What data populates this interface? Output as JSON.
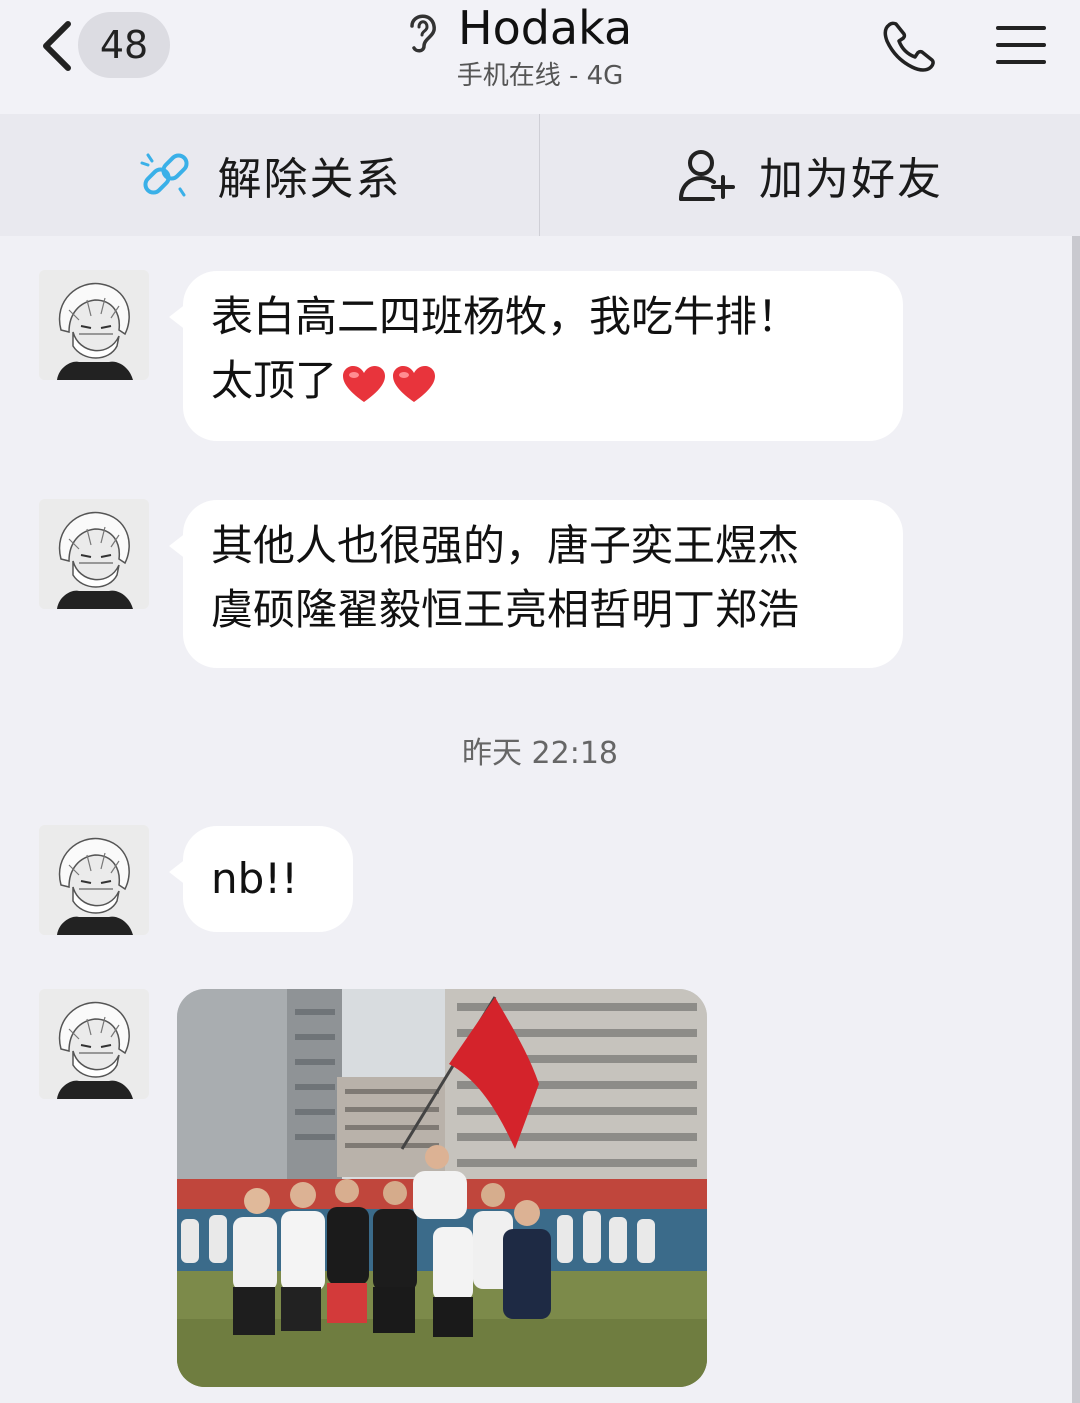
{
  "header": {
    "unread_count": "48",
    "title": "Hodaka",
    "status": "手机在线 - 4G"
  },
  "actions": {
    "unlink_label": "解除关系",
    "add_friend_label": "加为好友"
  },
  "messages": [
    {
      "lines": [
        "表白高二四班杨牧，我吃牛排！",
        "太顶了"
      ],
      "emoji_count": 2
    },
    {
      "lines": [
        "其他人也很强的，唐子奕王煜杰",
        "虞硕隆翟毅恒王亮相哲明丁郑浩"
      ]
    },
    {
      "lines": [
        "nb!!"
      ]
    }
  ],
  "timestamp": "昨天 22:18",
  "colors": {
    "background": "#f0f0f5",
    "bubble": "#ffffff",
    "link_icon": "#3ab0e8",
    "heart": "#e8343c",
    "flag": "#d4232b"
  },
  "icons": [
    "back-chevron-icon",
    "ear-icon",
    "phone-icon",
    "menu-icon",
    "unlink-icon",
    "add-user-icon",
    "heart-icon"
  ]
}
